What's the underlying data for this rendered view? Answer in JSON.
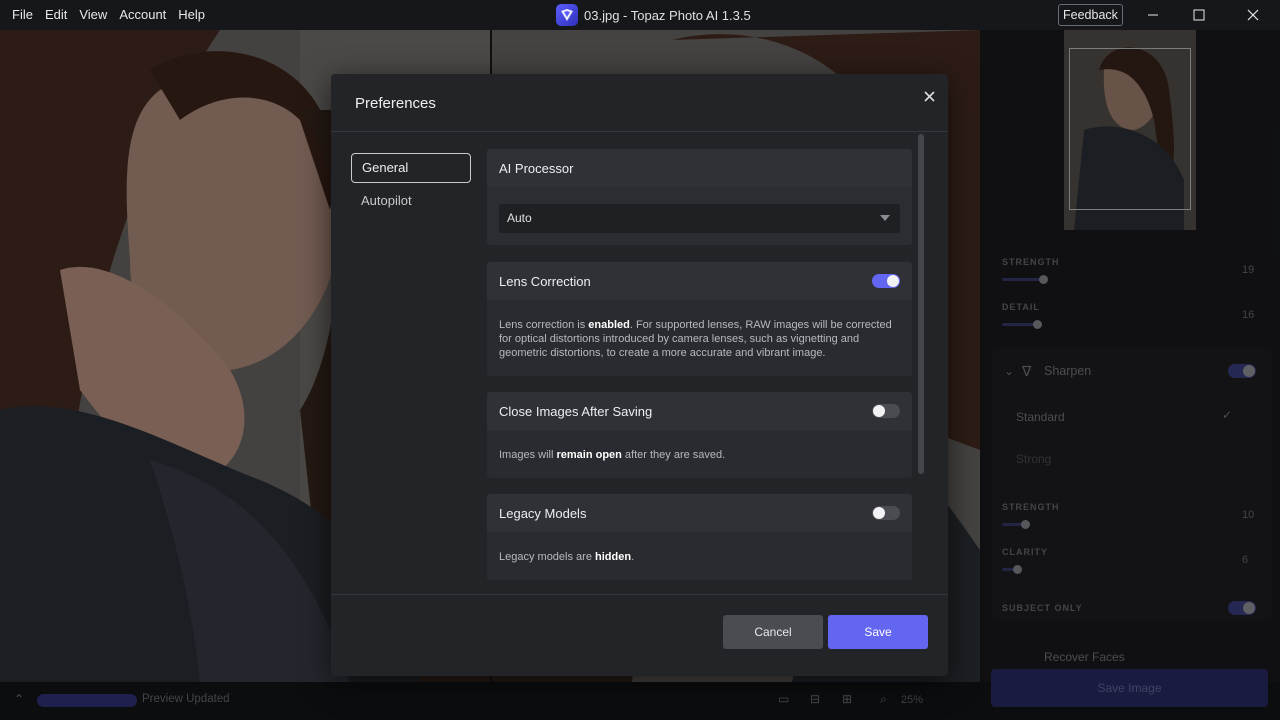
{
  "menu": [
    "File",
    "Edit",
    "View",
    "Account",
    "Help"
  ],
  "window": {
    "title": "03.jpg - Topaz Photo AI 1.3.5",
    "feedback_label": "Feedback"
  },
  "right_panel": {
    "strength_label": "STRENGTH",
    "strength_value": "19",
    "detail_label": "DETAIL",
    "detail_value": "16",
    "sharpen_label": "Sharpen",
    "standard_label": "Standard",
    "strong_label": "Strong",
    "strength2_label": "STRENGTH",
    "strength2_value": "10",
    "clarity_label": "CLARITY",
    "clarity_value": "6",
    "subject_only_label": "SUBJECT ONLY",
    "recover_faces_label": "Recover Faces"
  },
  "statusbar": {
    "status": "Preview Updated",
    "zoom": "25%",
    "save_image": "Save Image"
  },
  "preferences": {
    "title": "Preferences",
    "nav": [
      "General",
      "Autopilot"
    ],
    "ai_processor": {
      "label": "AI Processor",
      "value": "Auto"
    },
    "lens_correction": {
      "label": "Lens Correction",
      "enabled": true,
      "desc_pre": "Lens correction is ",
      "desc_bold": "enabled",
      "desc_post": ". For supported lenses, RAW images will be corrected for optical distortions introduced by camera lenses, such as vignetting and geometric distortions, to create a more accurate and vibrant image."
    },
    "close_after_saving": {
      "label": "Close Images After Saving",
      "enabled": false,
      "desc_pre": "Images will ",
      "desc_bold": "remain open",
      "desc_post": " after they are saved."
    },
    "legacy_models": {
      "label": "Legacy Models",
      "enabled": false,
      "desc_pre": "Legacy models are ",
      "desc_bold": "hidden",
      "desc_post": "."
    },
    "cancel_label": "Cancel",
    "save_label": "Save"
  },
  "colors": {
    "accent": "#6366f1",
    "modal_bg": "#232428",
    "card_bg": "#2c2d32"
  }
}
